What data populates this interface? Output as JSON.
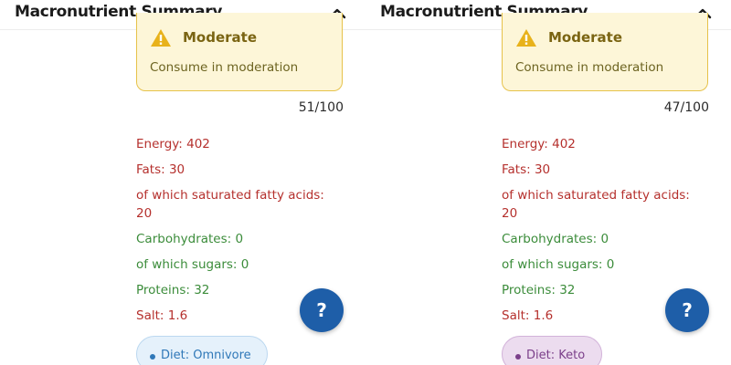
{
  "panels": [
    {
      "header": {
        "title": "Macronutrient Summary"
      },
      "warning": {
        "title": "Moderate",
        "description": "Consume in moderation"
      },
      "score": "51/100",
      "nutrients": {
        "energy": "Energy: 402",
        "fats": "Fats: 30",
        "saturated_label": "of which saturated fatty acids:",
        "saturated_value": "20",
        "carbohydrates": "Carbohydrates: 0",
        "sugars": "of which sugars: 0",
        "proteins": "Proteins: 32",
        "salt": "Salt: 1.6"
      },
      "help_label": "?",
      "diet": {
        "label": "Diet: Omnivore",
        "color": "#2f78b8"
      }
    },
    {
      "header": {
        "title": "Macronutrient Summary"
      },
      "warning": {
        "title": "Moderate",
        "description": "Consume in moderation"
      },
      "score": "47/100",
      "nutrients": {
        "energy": "Energy: 402",
        "fats": "Fats: 30",
        "saturated_label": "of which saturated fatty acids:",
        "saturated_value": "20",
        "carbohydrates": "Carbohydrates: 0",
        "sugars": "of which sugars: 0",
        "proteins": "Proteins: 32",
        "salt": "Salt: 1.6"
      },
      "help_label": "?",
      "diet": {
        "label": "Diet: Keto",
        "color": "#7b3f8a"
      }
    }
  ],
  "colors": {
    "warning_bg": "#fdf6d8",
    "warning_border": "#e6c24a",
    "negative": "#b5302d",
    "positive": "#3b8c3a",
    "help_button": "#1e5ea8"
  },
  "icons": {
    "collapse": "chevron-up-icon",
    "warning": "warning-triangle-icon"
  }
}
